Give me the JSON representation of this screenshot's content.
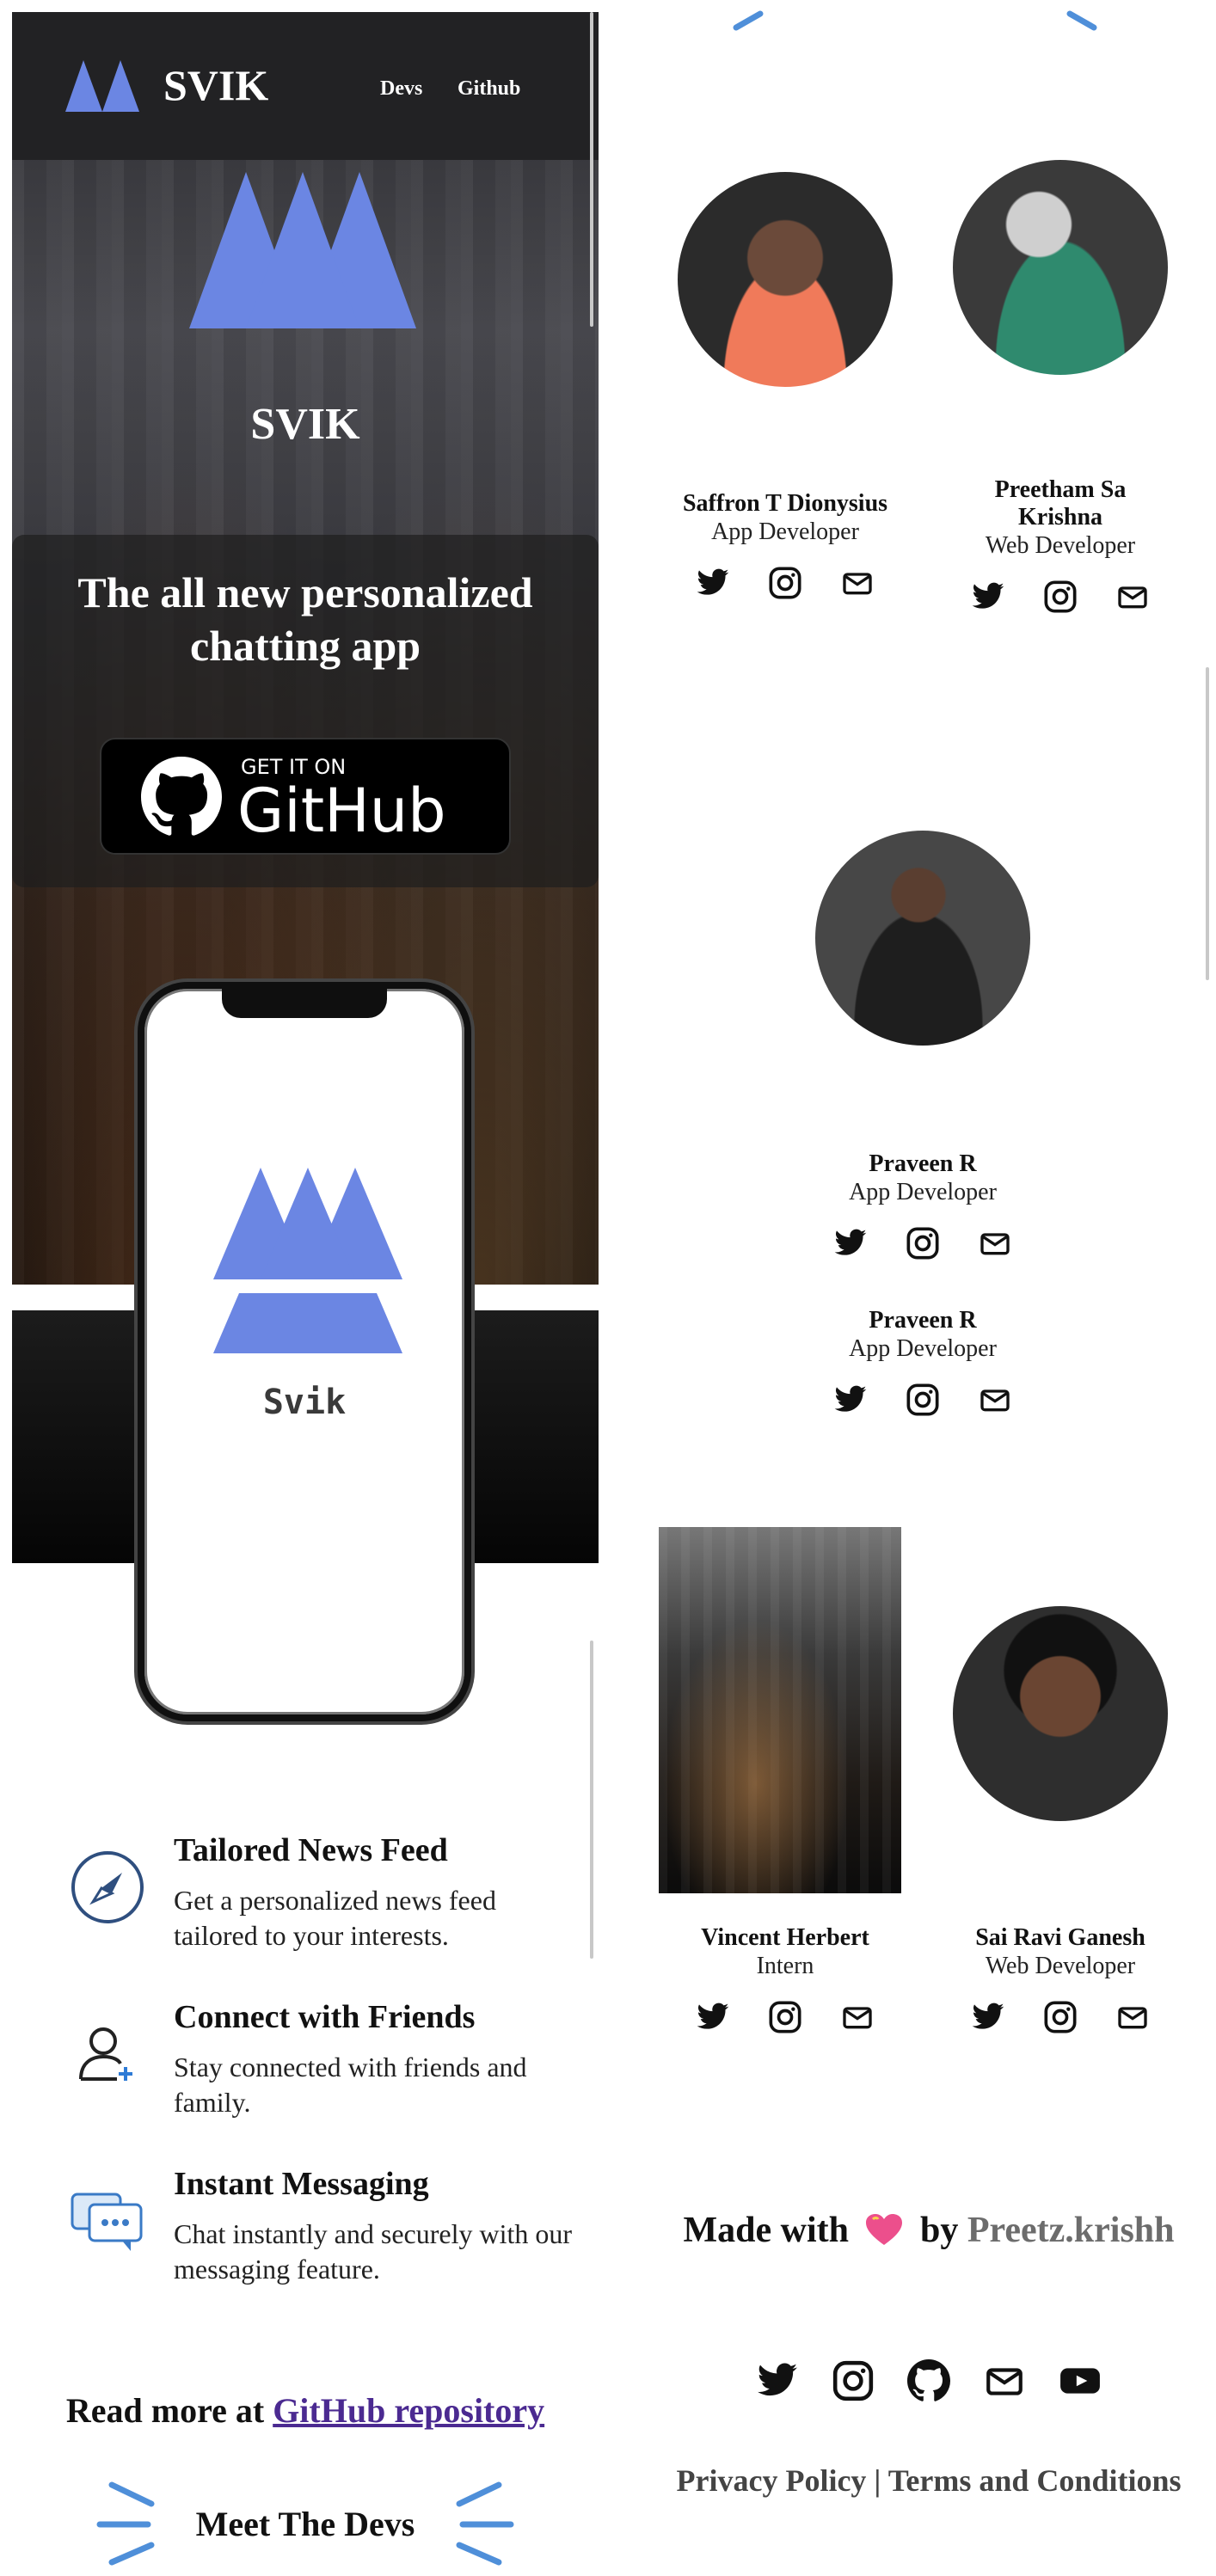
{
  "nav": {
    "brand": "SVIK",
    "links": [
      "Devs",
      "Github"
    ]
  },
  "hero": {
    "title": "SVIK",
    "tagline": "The all new personalized chatting app"
  },
  "github_button": {
    "small": "GET IT ON",
    "big": "GitHub"
  },
  "phone": {
    "app_name": "Svik"
  },
  "features": [
    {
      "title": "Tailored News Feed",
      "desc": "Get a personalized news feed tailored to your interests.",
      "icon": "compass-icon"
    },
    {
      "title": "Connect with Friends",
      "desc": "Stay connected with friends and family.",
      "icon": "add-user-icon"
    },
    {
      "title": "Instant Messaging",
      "desc": "Chat instantly and securely with our messaging feature.",
      "icon": "chat-icon"
    }
  ],
  "read_more": {
    "prefix": "Read more at ",
    "link": "GitHub repository"
  },
  "meet": {
    "title": "Meet The Devs"
  },
  "devs": [
    {
      "name": "Saffron T Dionysius",
      "role": "App Developer"
    },
    {
      "name": "Preetham Sa Krishna",
      "role": "Web Developer"
    },
    {
      "name": "Praveen R",
      "role": "App Developer"
    },
    {
      "name": "Praveen R",
      "role": "App Developer"
    },
    {
      "name": "Vincent Herbert",
      "role": "Intern"
    },
    {
      "name": "Sai Ravi Ganesh",
      "role": "Web Developer"
    }
  ],
  "footer": {
    "made_with": "Made with",
    "by": "by",
    "author": "Preetz.krishh",
    "icons": [
      "twitter-icon",
      "instagram-icon",
      "github-icon",
      "mail-icon",
      "youtube-icon"
    ],
    "privacy": "Privacy Policy",
    "separator": "|",
    "terms": "Terms and Conditions"
  },
  "colors": {
    "brand": "#6b86e3",
    "navbar": "#222224",
    "link": "#4b2a91",
    "author": "#6c6c6c",
    "ray": "#4f8fd9"
  }
}
